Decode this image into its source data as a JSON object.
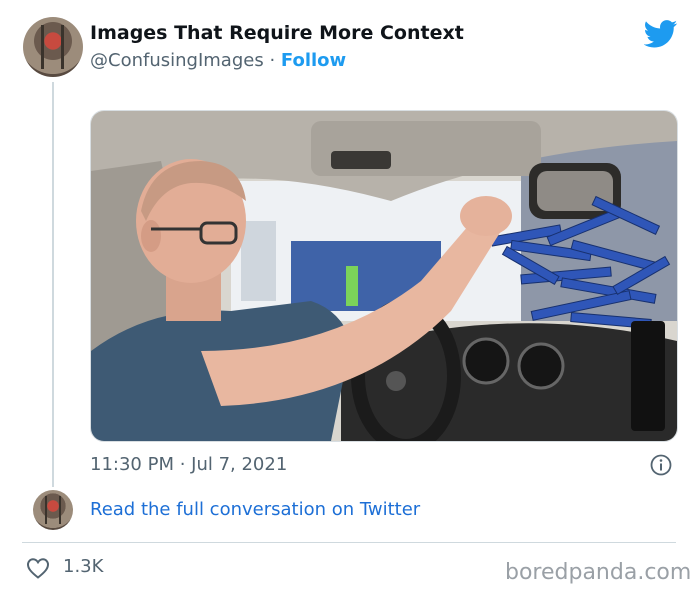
{
  "tweet": {
    "author_name": "Images That Require More Context",
    "handle": "@ConfusingImages",
    "separator": "·",
    "follow_label": "Follow",
    "timestamp": "11:30 PM · Jul 7, 2021",
    "read_link": "Read the full conversation on Twitter",
    "likes": "1.3K"
  },
  "watermark": "boredpanda.com",
  "icons": {
    "brand": "twitter-bird-icon",
    "info": "info-icon",
    "like": "heart-icon"
  },
  "colors": {
    "accent": "#1d9bf0",
    "link": "#1d6fd6",
    "secondary_text": "#536471"
  }
}
